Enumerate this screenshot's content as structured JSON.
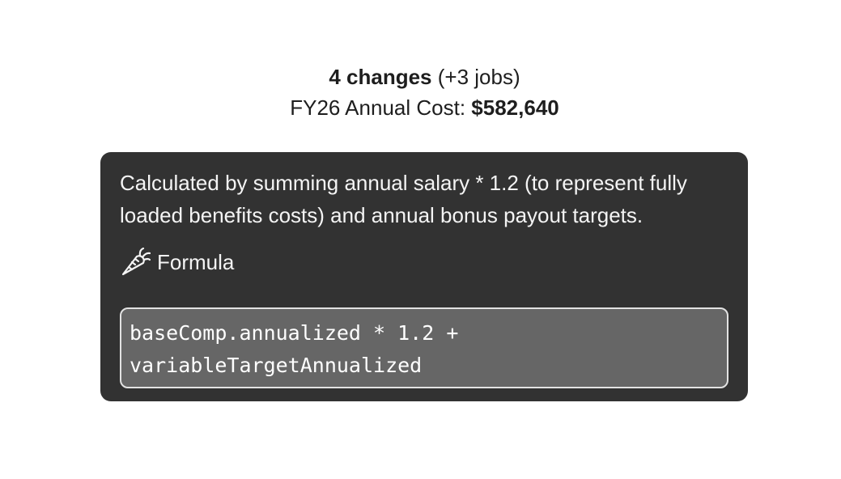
{
  "summary": {
    "changes_count": "4 changes",
    "jobs_delta": "(+3 jobs)",
    "cost_label": "FY26 Annual Cost:",
    "cost_value": "$582,640"
  },
  "tooltip": {
    "description": "Calculated by summing annual salary * 1.2 (to represent fully loaded benefits costs) and annual bonus payout targets.",
    "formula_icon": "carrot-icon",
    "formula_label": "Formula",
    "formula_line1": "baseComp.annualized * 1.2 +",
    "formula_line2": "variableTargetAnnualized"
  },
  "colors": {
    "tooltip_background": "#323232",
    "formula_background": "#666666",
    "formula_border": "#e2e2e2"
  }
}
